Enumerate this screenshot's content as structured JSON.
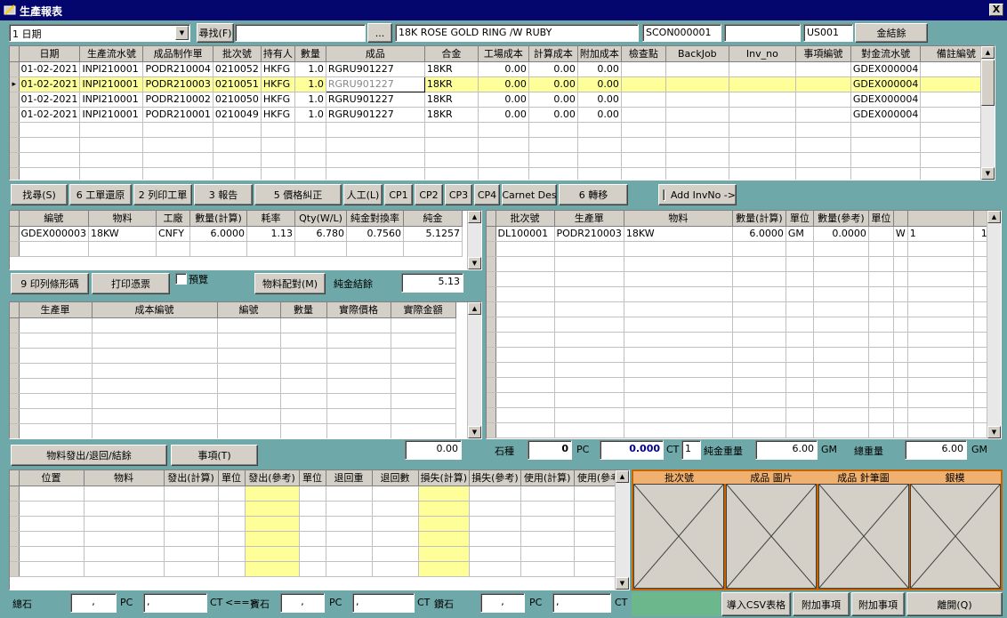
{
  "window": {
    "title": "生產報表",
    "close": "X"
  },
  "top": {
    "filter_select": "1 日期",
    "search_btn": "尋找(F)",
    "search_value": "",
    "browse_btn": "...",
    "desc": "18K ROSE GOLD RING /W RUBY",
    "scon": "SCON000001",
    "blank": "",
    "user": "US001",
    "gold_balance_btn": "金結餘"
  },
  "main_grid": {
    "headers": [
      "日期",
      "生產流水號",
      "成品制作單",
      "批次號",
      "持有人",
      "數量",
      "成品",
      "合金",
      "工場成本",
      "計算成本",
      "附加成本",
      "檢查點",
      "BackJob",
      "Inv_no",
      "事項編號",
      "對金流水號",
      "備註編號"
    ],
    "rows": [
      [
        "01-02-2021",
        "INPI210001",
        "PODR210004",
        "0210052",
        "HKFG",
        "1.0",
        "RGRU901227",
        "18KR",
        "0.00",
        "0.00",
        "0.00",
        "",
        "",
        "",
        "",
        "GDEX000004",
        ""
      ],
      [
        "01-02-2021",
        "INPI210001",
        "PODR210003",
        "0210051",
        "HKFG",
        "1.0",
        "RGRU901227",
        "18KR",
        "0.00",
        "0.00",
        "0.00",
        "",
        "",
        "",
        "",
        "GDEX000004",
        ""
      ],
      [
        "01-02-2021",
        "INPI210001",
        "PODR210002",
        "0210050",
        "HKFG",
        "1.0",
        "RGRU901227",
        "18KR",
        "0.00",
        "0.00",
        "0.00",
        "",
        "",
        "",
        "",
        "GDEX000004",
        ""
      ],
      [
        "01-02-2021",
        "INPI210001",
        "PODR210001",
        "0210049",
        "HKFG",
        "1.0",
        "RGRU901227",
        "18KR",
        "0.00",
        "0.00",
        "0.00",
        "",
        "",
        "",
        "",
        "GDEX000004",
        ""
      ]
    ],
    "selected_row": 1
  },
  "toolbar": {
    "find": "找尋(S)",
    "restore": "6 工單還原",
    "print_order": "2 列印工單",
    "report": "3 報告",
    "price_fix": "5 價格糾正",
    "labor": "人工(L)",
    "cp1": "CP1",
    "cp2": "CP2",
    "cp3": "CP3",
    "cp4": "CP4",
    "carnet": "Carnet Des",
    "transfer": "6 轉移",
    "add_invno": "Add InvNo ->"
  },
  "mat_grid": {
    "headers": [
      "編號",
      "物料",
      "工廠",
      "數量(計算)",
      "耗率",
      "Qty(W/L)",
      "純金對換率",
      "純金"
    ],
    "rows": [
      [
        "GDEX000003",
        "18KW",
        "CNFY",
        "6.0000",
        "1.13",
        "6.780",
        "0.7560",
        "5.1257"
      ]
    ]
  },
  "batch_grid": {
    "headers": [
      "批次號",
      "生產單",
      "物料",
      "數量(計算)",
      "單位",
      "數量(參考)",
      "單位",
      "",
      "",
      ""
    ],
    "rows": [
      [
        "DL100001",
        "PODR210003",
        "18KW",
        "6.0000",
        "GM",
        "0.0000",
        "",
        "W",
        "1",
        "1"
      ]
    ]
  },
  "mid": {
    "print_barcode": "9 印列條形碼",
    "print_voucher": "打印憑票",
    "preview": "預覽",
    "mat_match": "物料配對(M)",
    "pure_gold_lbl": "純金結餘",
    "pure_gold_val": "5.13"
  },
  "cost_grid": {
    "headers": [
      "生產單",
      "成本編號",
      "編號",
      "數量",
      "實際價格",
      "實際金額"
    ]
  },
  "summary": {
    "issue_btn": "物料發出/退回/結餘",
    "event_btn": "事項(T)",
    "amount": "0.00",
    "stone_lbl": "石種",
    "stone_pc": "0",
    "pc": "PC",
    "stone_ct": "0.000",
    "ct": "CT",
    "ct_num": "1",
    "net_gold_lbl": "純金重量",
    "net_gold": "6.00",
    "gm": "GM",
    "total_wt_lbl": "總重量",
    "total_wt": "6.00"
  },
  "issue_grid": {
    "headers": [
      "位置",
      "物料",
      "發出(計算)",
      "單位",
      "發出(參考)",
      "單位",
      "退回重",
      "退回數",
      "損失(計算)",
      "損失(參考)",
      "使用(計算)",
      "使用(參考)"
    ]
  },
  "image_panel": {
    "headers": [
      "批次號",
      "成品 圖片",
      "成品 針筆圖",
      "銀模"
    ]
  },
  "footer": {
    "total_stone": "總石",
    "pc": "PC",
    "ct": "CT",
    "arrow": "<==>",
    "gem": "寶石",
    "diamond": "鑽石",
    "dot": ",",
    "import_csv": "導入CSV表格",
    "addon1": "附加事項",
    "addon2": "附加事項",
    "leave": "離開(Q)"
  }
}
